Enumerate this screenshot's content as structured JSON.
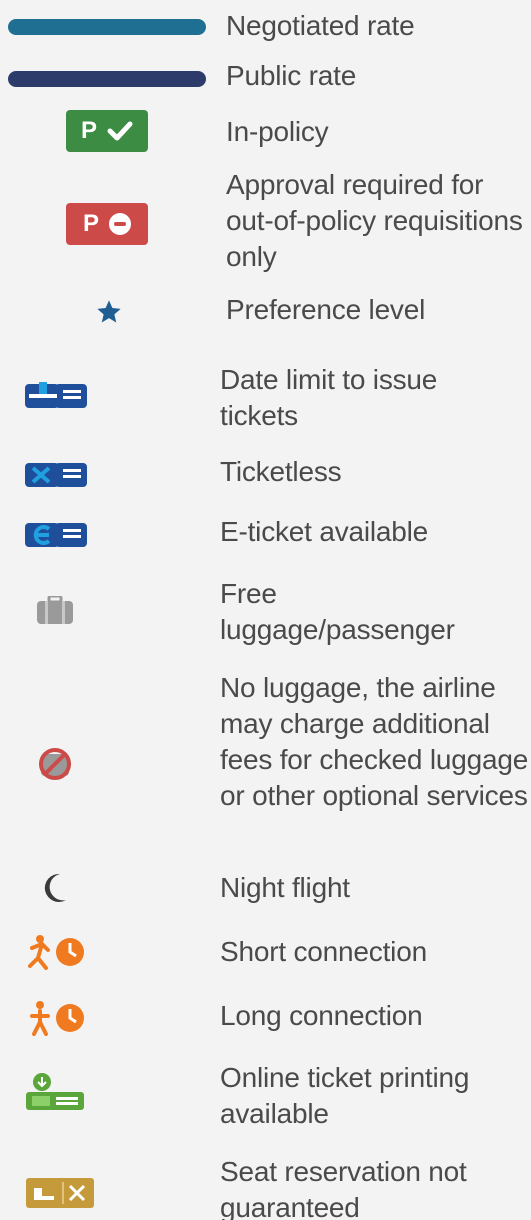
{
  "legend": {
    "items": [
      {
        "label": "Negotiated rate",
        "icon": "negotiated-rate-bar",
        "color": "#1f6f93"
      },
      {
        "label": "Public rate",
        "icon": "public-rate-bar",
        "color": "#2d3b6a"
      },
      {
        "label": "In-policy",
        "icon": "in-policy-badge-icon",
        "badge_letter": "P",
        "color": "#3d8c44"
      },
      {
        "label": "Approval required for out-of-policy requisitions only",
        "icon": "approval-required-badge-icon",
        "badge_letter": "P",
        "color": "#cc4b49"
      },
      {
        "label": "Preference level",
        "icon": "star-icon",
        "color": "#1f5d93"
      },
      {
        "label": "Date limit to issue tickets",
        "icon": "ticket-date-limit-icon",
        "color": "#1f4f9b"
      },
      {
        "label": "Ticketless",
        "icon": "ticketless-icon",
        "color": "#1f4f9b"
      },
      {
        "label": "E-ticket available",
        "icon": "e-ticket-icon",
        "color": "#1f4f9b"
      },
      {
        "label": "Free luggage/passenger",
        "icon": "luggage-icon",
        "color": "#9a9a9a"
      },
      {
        "label": "No luggage, the airline may charge additional fees for checked luggage or other optional services",
        "icon": "no-luggage-icon",
        "color": "#cc4b49"
      },
      {
        "label": "Night flight",
        "icon": "moon-icon",
        "color": "#3a3a3a"
      },
      {
        "label": "Short connection",
        "icon": "short-connection-icon",
        "color": "#f07a20"
      },
      {
        "label": "Long connection",
        "icon": "long-connection-icon",
        "color": "#f07a20"
      },
      {
        "label": "Online ticket printing available",
        "icon": "online-ticket-printing-icon",
        "color": "#5aa63a"
      },
      {
        "label": "Seat reservation not guaranteed",
        "icon": "seat-reservation-icon",
        "color": "#c49a3a"
      }
    ]
  }
}
